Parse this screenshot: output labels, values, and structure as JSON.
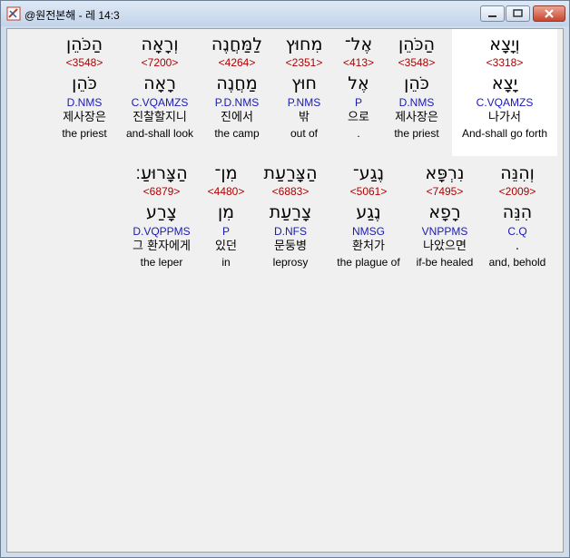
{
  "window": {
    "title": "@원전본해 - 레 14:3",
    "buttons": {
      "minimize": "minimize-icon",
      "maximize": "maximize-icon",
      "close": "close-icon"
    }
  },
  "colors": {
    "strong": "#b00000",
    "parse": "#1a1ab4",
    "text": "#000000",
    "background": "#f0f0f0"
  },
  "rows": [
    {
      "words": [
        {
          "hebrew": "הַכֹּהֵן",
          "strong": "<3548>",
          "lemma": "כֹּהֵן",
          "parse": "D.NMS",
          "korean": "제사장은",
          "english": "the priest"
        },
        {
          "hebrew": "וְרָאָה",
          "strong": "<7200>",
          "lemma": "רָאָה",
          "parse": "C.VQAMZS",
          "korean": "진찰할지니",
          "english": "and-shall look"
        },
        {
          "hebrew": "לַמַּחֲנֶה",
          "strong": "<4264>",
          "lemma": "מַחֲנֶה",
          "parse": "P.D.NMS",
          "korean": "진에서",
          "english": "the camp"
        },
        {
          "hebrew": "מִחוּץ",
          "strong": "<2351>",
          "lemma": "חוּץ",
          "parse": "P.NMS",
          "korean": "밖",
          "english": "out of"
        },
        {
          "hebrew": "אֶל־",
          "strong": "<413>",
          "lemma": "אֶל",
          "parse": "P",
          "korean": "으로",
          "english": "."
        },
        {
          "hebrew": "הַכֹּהֵן",
          "strong": "<3548>",
          "lemma": "כֹּהֵן",
          "parse": "D.NMS",
          "korean": "제사장은",
          "english": "the priest"
        },
        {
          "hebrew": "וְיָצָא",
          "strong": "<3318>",
          "lemma": "יָצָא",
          "parse": "C.VQAMZS",
          "korean": "나가서",
          "english": "And-shall go forth",
          "selected": true
        }
      ]
    },
    {
      "words": [
        {
          "hebrew": "הַצָּרוּעַ׃",
          "strong": "<6879>",
          "lemma": "צָרַע",
          "parse": "D.VQPPMS",
          "korean": "그 환자에게",
          "english": "the leper"
        },
        {
          "hebrew": "מִן־",
          "strong": "<4480>",
          "lemma": "מִן",
          "parse": "P",
          "korean": "있던",
          "english": "in"
        },
        {
          "hebrew": "הַצָּרַעַת",
          "strong": "<6883>",
          "lemma": "צָרַעַת",
          "parse": "D.NFS",
          "korean": "문둥병",
          "english": "leprosy"
        },
        {
          "hebrew": "נֶגַע־",
          "strong": "<5061>",
          "lemma": "נֶגַע",
          "parse": "NMSG",
          "korean": "환처가",
          "english": "the plague of"
        },
        {
          "hebrew": "נִרְפָּא",
          "strong": "<7495>",
          "lemma": "רָפָא",
          "parse": "VNPPMS",
          "korean": "나았으면",
          "english": "if-be healed"
        },
        {
          "hebrew": "וְהִנֵּה",
          "strong": "<2009>",
          "lemma": "הִנֵּה",
          "parse": "C.Q",
          "korean": ".",
          "english": "and, behold"
        }
      ]
    }
  ]
}
